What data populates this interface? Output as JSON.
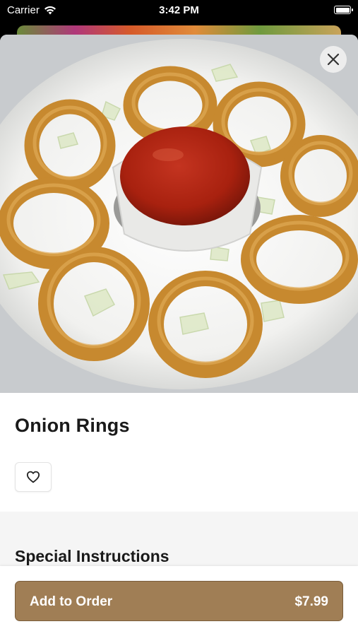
{
  "status_bar": {
    "carrier": "Carrier",
    "time": "3:42 PM"
  },
  "item": {
    "title": "Onion Rings",
    "image_icon": "photo-icon"
  },
  "actions": {
    "close_icon": "close-icon",
    "favorite_icon": "heart-icon"
  },
  "special_instructions": {
    "heading": "Special Instructions"
  },
  "order_button": {
    "label": "Add to Order",
    "price": "$7.99"
  },
  "colors": {
    "accent": "#a07e55",
    "accent_border": "#7a5d3b",
    "section_background": "#f5f5f5"
  }
}
